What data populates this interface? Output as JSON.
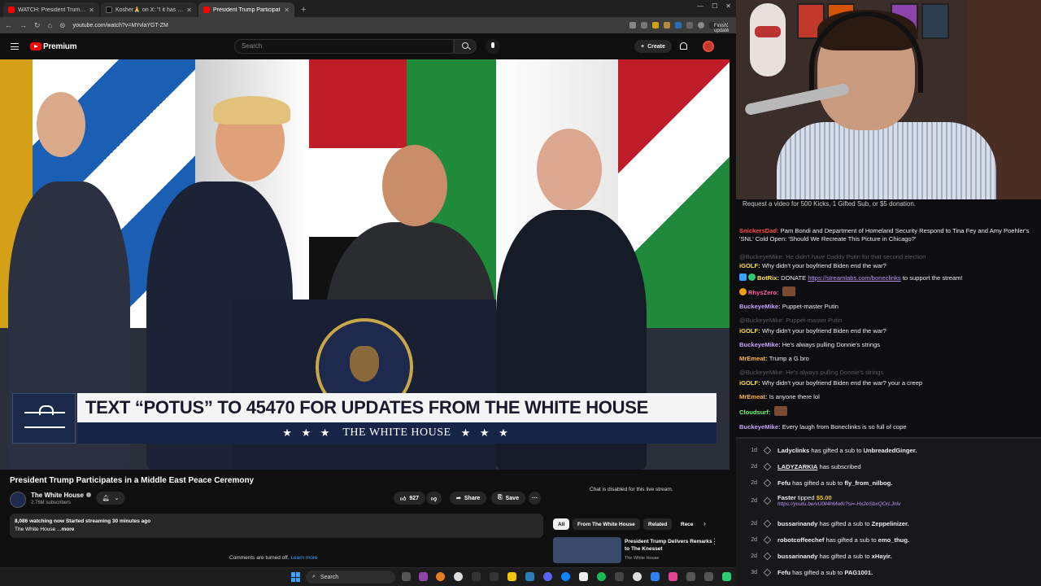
{
  "browser": {
    "tabs": [
      {
        "title": "WATCH: President Trump Addr",
        "active": false,
        "favicon_color": "#ff0000"
      },
      {
        "title": "Kosher🙏 on X: \"I it has just",
        "active": false,
        "favicon_color": "#111111"
      },
      {
        "title": "President Trump Participat",
        "active": true,
        "favicon_color": "#ff0000"
      }
    ],
    "url": "youtube.com/watch?v=MYvlaYGT-ZM",
    "finish_update": "Finish update"
  },
  "youtube": {
    "logo_text": "Premium",
    "search_placeholder": "Search",
    "create_label": "Create",
    "video_title": "President Trump Participates in a Middle East Peace Ceremony",
    "channel": "The White House",
    "subscribers": "2.76M subscribers",
    "likes": "927",
    "share_label": "Share",
    "save_label": "Save",
    "description_line1": "8,086 watching now  Started streaming 30 minutes ago",
    "description_line2": "The White House ...",
    "description_more": "more",
    "comments_off": "Comments are turned off.",
    "learn_more": "Learn more",
    "chat_disabled": "Chat is disabled for this live stream.",
    "chips": [
      "All",
      "From The White House",
      "Related",
      "Rece"
    ],
    "related": {
      "title": "President Trump Delivers Remarks to The Knesset",
      "channel": "The White House"
    },
    "lower_third": {
      "headline": "TEXT “POTUS” TO 45470 FOR UPDATES FROM THE WHITE HOUSE",
      "stars": "★ ★ ★",
      "brand": "THE WHITE HOUSE"
    }
  },
  "taskbar": {
    "search": "Search"
  },
  "chat": {
    "banner": "Request a video for 500 Kicks, 1 Gifted Sub, or $5 donation.",
    "messages": [
      {
        "user": "SnickersDad",
        "text": "Pam Bondi and Department of Homeland Security Respond to Tina Fey and Amy Poehler's 'SNL' Cold Open: 'Should We Recreate This Picture in Chicago?'",
        "color": "#ff4a4a",
        "deleted": false
      },
      {
        "user": "",
        "text": "@BuckeyeMike: He didn't have Daddy Putin for that second election",
        "color": "#5a5a5e",
        "deleted": true
      },
      {
        "user": "iGOLF",
        "text": "Why didn't your boyfriend Biden end the war?",
        "color": "#ffe14a",
        "deleted": false
      },
      {
        "user": "BotRix",
        "text": "DONATE ",
        "link": "https://streamlabs.com/boneclinks",
        "after": " to support the stream!",
        "color": "#ffe14a",
        "deleted": false
      },
      {
        "user": "RhysZero",
        "text": "",
        "color": "#ff5fa0",
        "deleted": false
      },
      {
        "user": "BuckeyeMike",
        "text": "Puppet-master Putin",
        "color": "#c7a6ff",
        "deleted": false
      },
      {
        "user": "",
        "text": "@BuckeyeMike: Puppet-master Putin",
        "color": "#5a5a5e",
        "deleted": true
      },
      {
        "user": "iGOLF",
        "text": "Why didn't your boyfriend Biden end the war?",
        "color": "#ffe14a",
        "deleted": false
      },
      {
        "user": "BuckeyeMike",
        "text": "He's always pulling Donnie's strings",
        "color": "#c7a6ff",
        "deleted": false
      },
      {
        "user": "MrEmeat",
        "text": "Trump a G bro",
        "color": "#ffb347",
        "deleted": false
      },
      {
        "user": "",
        "text": "@BuckeyeMike: He's always pulling Donnie's strings",
        "color": "#5a5a5e",
        "deleted": true
      },
      {
        "user": "iGOLF",
        "text": "Why didn't your boyfriend Biden end the war? your a creep",
        "color": "#ffe14a",
        "deleted": false
      },
      {
        "user": "MrEmeat",
        "text": "Is anyone there lol",
        "color": "#ffb347",
        "deleted": false
      },
      {
        "user": "Cloudsurf",
        "text": "",
        "color": "#6aff6a",
        "deleted": false
      },
      {
        "user": "BuckeyeMike",
        "text": "Every laugh from Boneclinks is so full of cope",
        "color": "#c7a6ff",
        "deleted": false
      }
    ]
  },
  "feed": [
    {
      "time": "1d",
      "user": "Ladyclinks",
      "action": "has gifted a sub to",
      "target": "UnbreadedGinger."
    },
    {
      "time": "2d",
      "user": "LADYZARKIA",
      "action": "has subscribed",
      "target": ""
    },
    {
      "time": "2d",
      "user": "Fefu",
      "action": "has gifted a sub to",
      "target": "fly_from_nilbog."
    },
    {
      "time": "2d",
      "user": "Faster",
      "action": "tipped",
      "target": "$5.00",
      "link": "https://youtu.be/vU0ll4hMwfc?si=-Hx2oSbxQOrLJnlv"
    },
    {
      "time": "2d",
      "user": "bussarinandy",
      "action": "has gifted a sub to",
      "target": "Zeppelinizer."
    },
    {
      "time": "2d",
      "user": "robotcoffeechef",
      "action": "has gifted a sub to",
      "target": "emo_thug."
    },
    {
      "time": "2d",
      "user": "bussarinandy",
      "action": "has gifted a sub to",
      "target": "xHayir."
    },
    {
      "time": "3d",
      "user": "Fefu",
      "action": "has gifted a sub to",
      "target": "PAG1001."
    }
  ]
}
